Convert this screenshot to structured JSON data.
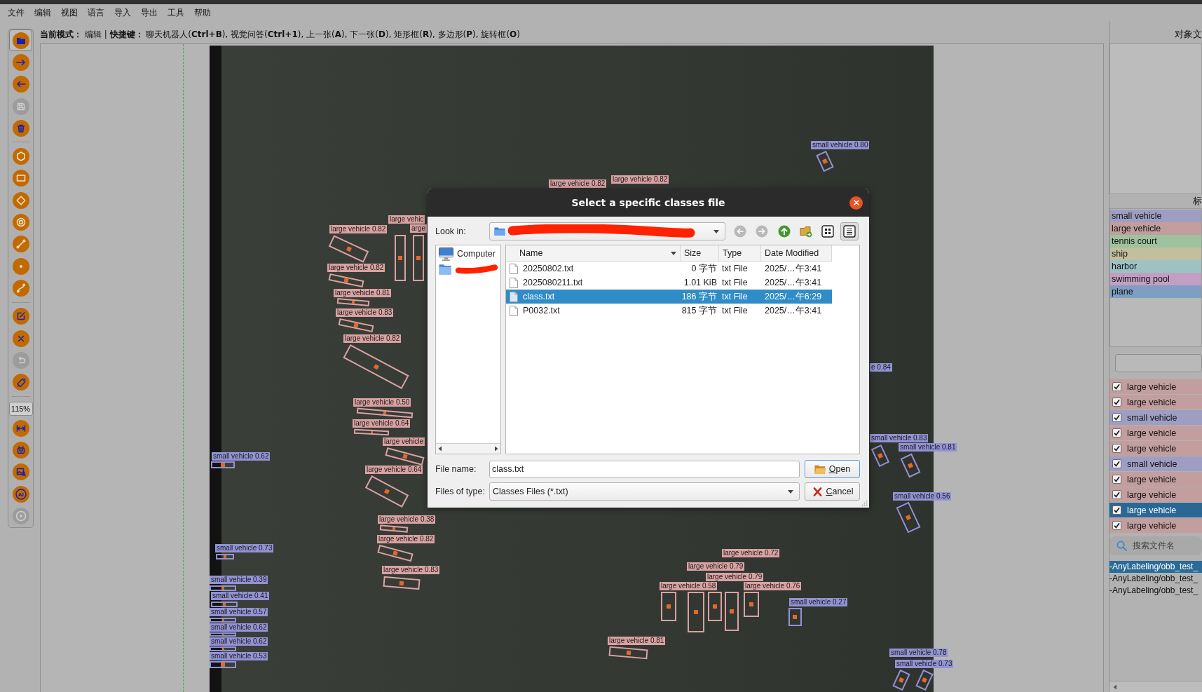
{
  "menu_bar": [
    "文件",
    "编辑",
    "视图",
    "语言",
    "导入",
    "导出",
    "工具",
    "帮助"
  ],
  "mode_line": "**当前模式：** 编辑 | **快捷键：** 聊天机器人(**Ctrl+B**), 视觉问答(**Ctrl+1**), 上一张(**A**), 下一张(**D**), 矩形框(**R**), 多边形(**P**), 旋转框(**O**)",
  "toolbar": {
    "items": [
      {
        "kind": "button",
        "disabled": false,
        "highlighted": true
      },
      {
        "kind": "button",
        "disabled": false,
        "highlighted": false
      },
      {
        "kind": "button",
        "disabled": false,
        "highlighted": false
      },
      {
        "kind": "button",
        "disabled": true,
        "highlighted": false
      },
      {
        "kind": "button",
        "disabled": false,
        "highlighted": false
      },
      {
        "kind": "separator"
      },
      {
        "kind": "button",
        "disabled": false,
        "highlighted": false
      },
      {
        "kind": "button",
        "disabled": false,
        "highlighted": false
      },
      {
        "kind": "button",
        "disabled": false,
        "highlighted": false
      },
      {
        "kind": "button",
        "disabled": false,
        "highlighted": false
      },
      {
        "kind": "button",
        "disabled": false,
        "highlighted": false
      },
      {
        "kind": "button",
        "disabled": false,
        "highlighted": false
      },
      {
        "kind": "button",
        "disabled": false,
        "highlighted": false
      },
      {
        "kind": "separator"
      },
      {
        "kind": "button",
        "disabled": false,
        "highlighted": false
      },
      {
        "kind": "button",
        "disabled": false,
        "highlighted": false
      },
      {
        "kind": "button",
        "disabled": true,
        "highlighted": false
      },
      {
        "kind": "button",
        "disabled": false,
        "highlighted": false
      },
      {
        "kind": "separator"
      },
      {
        "kind": "zoom",
        "value": "115%"
      },
      {
        "kind": "button",
        "disabled": false,
        "highlighted": false
      },
      {
        "kind": "button",
        "disabled": false,
        "highlighted": false
      },
      {
        "kind": "button",
        "disabled": false,
        "highlighted": false
      },
      {
        "kind": "button",
        "disabled": false,
        "highlighted": false,
        "glyph": "AI"
      },
      {
        "kind": "button",
        "disabled": true,
        "highlighted": false
      }
    ]
  },
  "canvas": {
    "detections": [
      {
        "label": "small vehicle 0.80",
        "color": "#9292d4"
      },
      {
        "label": "large vehicle 0.82",
        "color": "#d9a2a2"
      },
      {
        "label": "large vehicle 0.82",
        "color": "#d9a2a2"
      },
      {
        "label": "large vehic",
        "color": "#d9a2a2"
      },
      {
        "label": "large vehicle 0.82",
        "color": "#d9a2a2"
      },
      {
        "label": "arge",
        "color": "#d9a2a2"
      },
      {
        "label": "large vehicle 0.82",
        "color": "#d9a2a2"
      },
      {
        "label": "large vehicle 0.81",
        "color": "#d9a2a2"
      },
      {
        "label": "large vehicle 0.83",
        "color": "#d9a2a2"
      },
      {
        "label": "large vehicle 0.82",
        "color": "#d9a2a2"
      },
      {
        "label": "e 0.84",
        "color": "#9292d4"
      },
      {
        "label": "large vehicle 0.50",
        "color": "#d9a2a2"
      },
      {
        "label": "large vehicle 0.64",
        "color": "#d9a2a2"
      },
      {
        "label": "large vehicle",
        "color": "#d9a2a2"
      },
      {
        "label": "small vehicle 0.83",
        "color": "#9292d4"
      },
      {
        "label": "small vehicle 0.81",
        "color": "#9292d4"
      },
      {
        "label": "small vehicle 0.62",
        "color": "#9292d4"
      },
      {
        "label": "large vehicle 0.64",
        "color": "#d9a2a2"
      },
      {
        "label": "small vehicle 0.56",
        "color": "#9292d4"
      },
      {
        "label": "large vehicle 0.38",
        "color": "#d9a2a2"
      },
      {
        "label": "large vehicle 0.82",
        "color": "#d9a2a2"
      },
      {
        "label": "small vehicle 0.73",
        "color": "#9292d4"
      },
      {
        "label": "large vehicle 0.72",
        "color": "#d9a2a2"
      },
      {
        "label": "large vehicle 0.83",
        "color": "#d9a2a2"
      },
      {
        "label": "large vehicle 0.79",
        "color": "#d9a2a2"
      },
      {
        "label": "small vehicle 0.39",
        "color": "#9292d4"
      },
      {
        "label": "large vehicle 0.79",
        "color": "#d9a2a2"
      },
      {
        "label": "large vehicle 0.58",
        "color": "#d9a2a2"
      },
      {
        "label": "large vehicle 0.76",
        "color": "#d9a2a2"
      },
      {
        "label": "small vehicle 0.41",
        "color": "#9292d4"
      },
      {
        "label": "small vehicle 0.27",
        "color": "#9292d4"
      },
      {
        "label": "small vehicle 0.57",
        "color": "#9292d4"
      },
      {
        "label": "small vehicle 0.62",
        "color": "#9292d4"
      },
      {
        "label": "small vehicle 0.62",
        "color": "#9292d4"
      },
      {
        "label": "large vehicle 0.81",
        "color": "#d9a2a2"
      },
      {
        "label": "small vehicle 0.53",
        "color": "#9292d4"
      },
      {
        "label": "small vehicle 0.78",
        "color": "#9292d4"
      },
      {
        "label": "small vehicle 0.73",
        "color": "#9292d4"
      }
    ]
  },
  "dialog": {
    "title": "Select a specific classes file",
    "look_in": {
      "label": "Look in:",
      "redacted": true
    },
    "nav_buttons": [
      {
        "kind": "back",
        "disabled": true,
        "selected": false
      },
      {
        "kind": "forward",
        "disabled": true,
        "selected": false
      },
      {
        "kind": "up",
        "disabled": false,
        "selected": false
      },
      {
        "kind": "new_folder",
        "disabled": false,
        "selected": false
      },
      {
        "kind": "icon_view",
        "disabled": false,
        "selected": false
      },
      {
        "kind": "detail_view",
        "disabled": false,
        "selected": true
      }
    ],
    "places": [
      {
        "kind": "computer",
        "label": "Computer",
        "redacted": false
      },
      {
        "kind": "folder",
        "redacted": true
      }
    ],
    "columns": [
      {
        "label": "Name",
        "sorted": true
      },
      {
        "label": "Size",
        "sorted": false
      },
      {
        "label": "Type",
        "sorted": false
      },
      {
        "label": "Date Modified",
        "sorted": false
      }
    ],
    "files": [
      {
        "name": "20250802.txt",
        "size": "0 字节",
        "type": "txt File",
        "date": "2025/…午3:41",
        "selected": false
      },
      {
        "name": "2025080211.txt",
        "size": "1.01 KiB",
        "type": "txt File",
        "date": "2025/…午3:41",
        "selected": false
      },
      {
        "name": "class.txt",
        "size": "186 字节",
        "type": "txt File",
        "date": "2025/…午6:29",
        "selected": true
      },
      {
        "name": "P0032.txt",
        "size": "815 字节",
        "type": "txt File",
        "date": "2025/…午3:41",
        "selected": false
      }
    ],
    "file_name": {
      "label": "File name:",
      "value": "class.txt"
    },
    "file_type": {
      "label": "Files of type:",
      "value": "Classes Files (*.txt)"
    },
    "buttons": [
      {
        "kind": "open",
        "label": "Open",
        "default": true
      },
      {
        "kind": "cancel",
        "label": "Cancel",
        "default": false
      }
    ]
  },
  "right_panel": {
    "description_title": "对象文",
    "labels_title": "标",
    "labels": [
      {
        "name": "small vehicle",
        "color": "#9e9ec2"
      },
      {
        "name": "large vehicle",
        "color": "#c29e9e"
      },
      {
        "name": "tennis court",
        "color": "#9ec29e"
      },
      {
        "name": "ship",
        "color": "#c2be9e"
      },
      {
        "name": "harbor",
        "color": "#9ec2c2"
      },
      {
        "name": "swimming pool",
        "color": "#c29ec2"
      },
      {
        "name": "plane",
        "color": "#7e9ec2"
      }
    ],
    "shapes": [
      {
        "name": "large vehicle",
        "color": "#c29e9e",
        "checked": true,
        "selected": false
      },
      {
        "name": "large vehicle",
        "color": "#c29e9e",
        "checked": true,
        "selected": false
      },
      {
        "name": "small vehicle",
        "color": "#9e9ec2",
        "checked": true,
        "selected": false
      },
      {
        "name": "large vehicle",
        "color": "#c29e9e",
        "checked": true,
        "selected": false
      },
      {
        "name": "large vehicle",
        "color": "#c29e9e",
        "checked": true,
        "selected": false
      },
      {
        "name": "small vehicle",
        "color": "#9e9ec2",
        "checked": true,
        "selected": false
      },
      {
        "name": "large vehicle",
        "color": "#c29e9e",
        "checked": true,
        "selected": false
      },
      {
        "name": "large vehicle",
        "color": "#c29e9e",
        "checked": true,
        "selected": false
      },
      {
        "name": "large vehicle",
        "checked": true,
        "selected": true
      },
      {
        "name": "large vehicle",
        "color": "#c29e9e",
        "checked": true,
        "selected": false
      }
    ],
    "search": {
      "placeholder": "搜索文件名"
    },
    "files": [
      {
        "name": "-AnyLabeling/obb_test_",
        "selected": true
      },
      {
        "name": "-AnyLabeling/obb_test_",
        "selected": false
      },
      {
        "name": "-AnyLabeling/obb_test_",
        "selected": false
      }
    ]
  }
}
